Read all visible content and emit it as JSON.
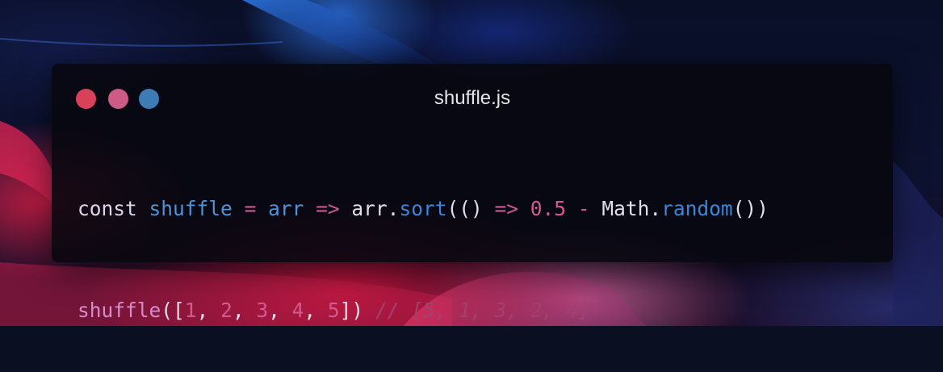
{
  "window": {
    "title": "shuffle.js",
    "controls": {
      "close_color": "#d9415a",
      "minimize_color": "#cc5b86",
      "maximize_color": "#3d7bb5"
    }
  },
  "code": {
    "language": "javascript",
    "lines": [
      "const shuffle = arr => arr.sort(() => 0.5 - Math.random())",
      "shuffle([1, 2, 3, 4, 5]) // [5, 1, 3, 2, 4]"
    ],
    "tokens": {
      "line1": {
        "kw_const": "const",
        "sp1": " ",
        "name_shuffle": "shuffle",
        "sp2": " ",
        "op_eq": "=",
        "sp3": " ",
        "name_arr": "arr",
        "sp4": " ",
        "op_arrow1": "=>",
        "sp5": " ",
        "plain_arr": "arr",
        "plain_dot1": ".",
        "fn_sort": "sort",
        "plain_open": "(()",
        "sp6": " ",
        "op_arrow2": "=>",
        "sp7": " ",
        "num_half": "0.5",
        "sp8": " ",
        "op_minus": "-",
        "sp9": " ",
        "plain_math": "Math",
        "plain_dot2": ".",
        "fn_random": "random",
        "plain_close": "())"
      },
      "line2": {
        "call_shuffle": "shuffle",
        "plain_open": "([",
        "num_1": "1",
        "sep1": ", ",
        "num_2": "2",
        "sep2": ", ",
        "num_3": "3",
        "sep3": ", ",
        "num_4": "4",
        "sep4": ", ",
        "num_5": "5",
        "plain_close": "])",
        "sp": " ",
        "comment": "// [5, 1, 3, 2, 4]"
      }
    }
  },
  "theme": {
    "keyword": "#dcd6ea",
    "identifier": "#4e92d8",
    "operator": "#c75a92",
    "number": "#d25a8c",
    "method": "#3b86d6",
    "call": "#d68bcb",
    "comment": "#a3416c"
  }
}
